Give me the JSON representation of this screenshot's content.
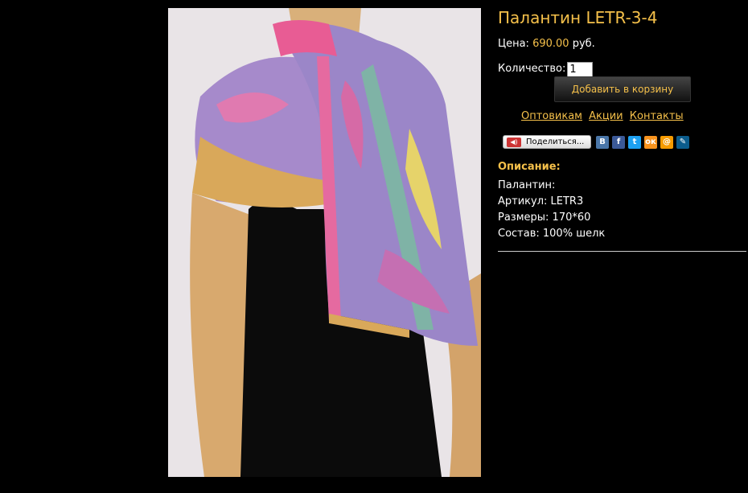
{
  "product": {
    "title": "Палантин LETR-3-4",
    "price_label": "Цена:",
    "price_value": "690.00",
    "price_currency": "руб.",
    "quantity_label": "Количество:",
    "quantity_value": "1",
    "add_to_cart_label": "Добавить в корзину"
  },
  "links": {
    "wholesale": "Оптовикам",
    "promotions": "Акции",
    "contacts": "Контакты"
  },
  "share": {
    "button_label": "Поделиться...",
    "networks": [
      "vkontakte-icon",
      "facebook-icon",
      "twitter-icon",
      "odnoklassniki-icon",
      "mailru-icon",
      "livejournal-icon"
    ]
  },
  "description": {
    "heading": "Описание:",
    "lines": [
      "Палантин:",
      "Артикул: LETR3",
      "Размеры: 170*60",
      "Состав: 100% шелк"
    ]
  },
  "colors": {
    "accent": "#f5c04a",
    "background": "#000000"
  }
}
